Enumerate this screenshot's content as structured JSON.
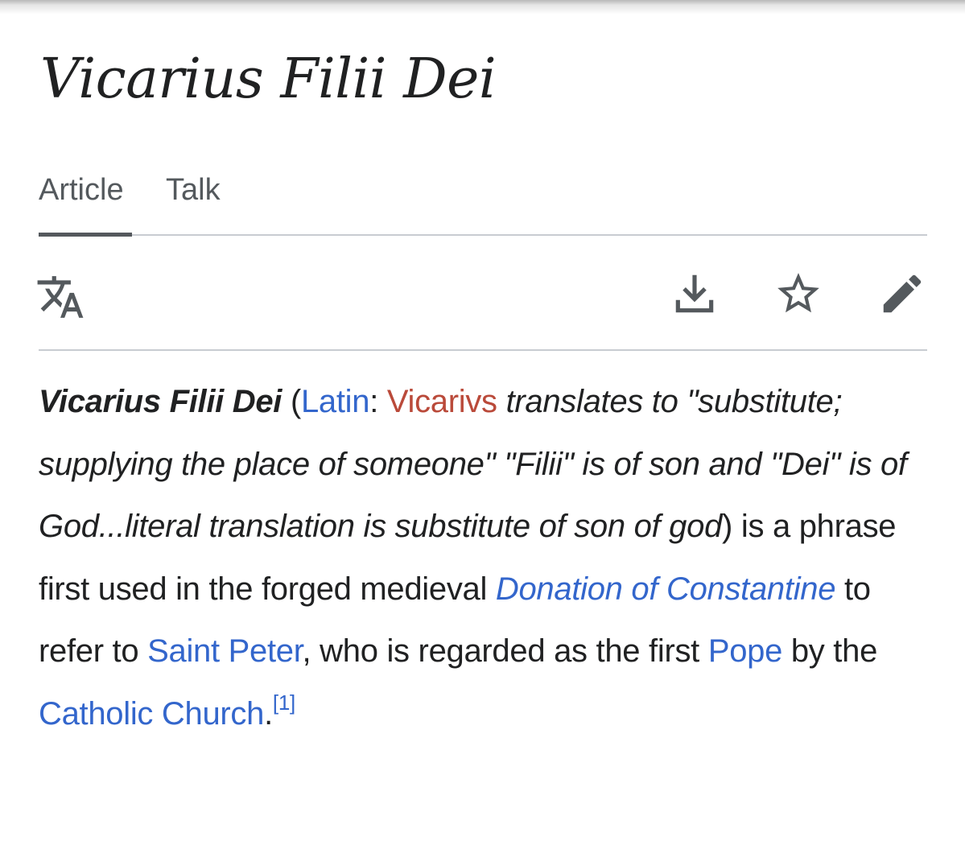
{
  "page": {
    "title": "Vicarius Filii Dei"
  },
  "tabs": [
    {
      "label": "Article",
      "selected": true
    },
    {
      "label": "Talk",
      "selected": false
    }
  ],
  "toolbar": {
    "icons": [
      "language-icon",
      "download-icon",
      "star-icon",
      "pencil-icon"
    ]
  },
  "lead": {
    "term": "Vicarius Filii Dei",
    "open_paren": " (",
    "latin_link": "Latin",
    "colon": ": ",
    "vicarivs_link": "Vicarivs",
    "translation_text": " translates to \"substitute; supplying the place of someone\" \"Filii\" is of son and \"Dei\" is of God...literal translation is substitute of son of god",
    "after_paren": ") is a phrase first used in the forged medieval ",
    "donation_link": "Donation of Constantine",
    "text_to_refer": " to refer to ",
    "saint_peter_link": "Saint Peter",
    "text_who": ", who is regarded as the first ",
    "pope_link": "Pope",
    "text_by_the": " by the ",
    "catholic_link": "Catholic Church",
    "period": ".",
    "ref": "[1]"
  },
  "colors": {
    "text": "#202122",
    "link": "#3366cc",
    "redlink": "#ba4a3a",
    "tab_indicator": "#54595d",
    "divider": "#c8ccd1"
  }
}
